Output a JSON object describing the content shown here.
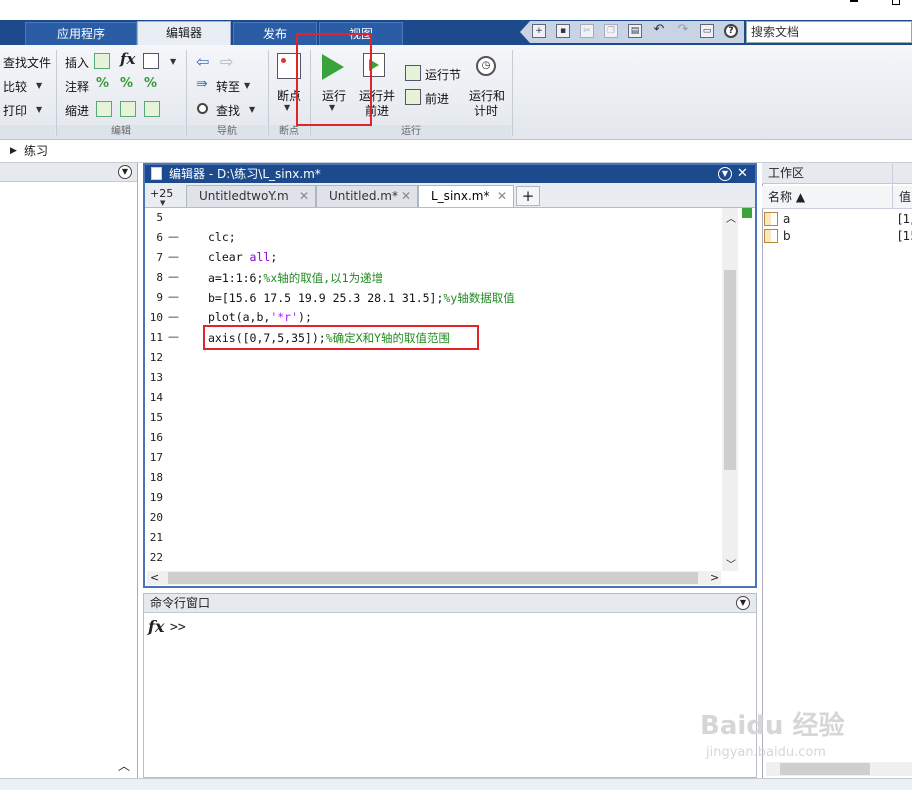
{
  "tabs": [
    {
      "label": "应用程序",
      "active": false
    },
    {
      "label": "编辑器",
      "active": true
    },
    {
      "label": "发布",
      "active": false
    },
    {
      "label": "视图",
      "active": false
    }
  ],
  "search": {
    "placeholder": "搜索文档"
  },
  "ribbon": {
    "file": {
      "find_files": "查找文件",
      "compare": "比较",
      "print": "打印"
    },
    "edit": {
      "insert": "插入",
      "comment": "注释",
      "indent": "缩进",
      "fx": "fx",
      "group": "编辑"
    },
    "navigate": {
      "goto": "转至",
      "find": "查找",
      "group": "导航"
    },
    "breakpoints": {
      "label": "断点",
      "group": "断点"
    },
    "run": {
      "run": "运行",
      "run_advance_line1": "运行并",
      "run_advance_line2": "前进",
      "run_section": "运行节",
      "advance": "前进",
      "run_time_line1": "运行和",
      "run_time_line2": "计时",
      "group": "运行"
    }
  },
  "address": {
    "crumb": "练习"
  },
  "editor": {
    "title": "编辑器 - D:\\练习\\L_sinx.m*",
    "tab_more": "+25",
    "tabs": [
      {
        "label": "UntitledtwoY.m",
        "active": false
      },
      {
        "label": "Untitled.m*",
        "active": false
      },
      {
        "label": "L_sinx.m*",
        "active": true
      }
    ],
    "add_tab": "+",
    "lines": [
      {
        "num": "5",
        "dash": "",
        "code": ""
      },
      {
        "num": "6",
        "dash": "—",
        "code": "clc;"
      },
      {
        "num": "7",
        "dash": "—",
        "code": "clear all;"
      },
      {
        "num": "8",
        "dash": "—",
        "code": "a=1:1:6;%x轴的取值,以1为递增"
      },
      {
        "num": "9",
        "dash": "—",
        "code": "b=[15.6 17.5 19.9 25.3 28.1 31.5];%y轴数据取值"
      },
      {
        "num": "10",
        "dash": "—",
        "code": "plot(a,b,'*r');"
      },
      {
        "num": "11",
        "dash": "—",
        "code": "axis([0,7,5,35]);%确定X和Y轴的取值范围"
      },
      {
        "num": "12",
        "dash": "",
        "code": ""
      },
      {
        "num": "13",
        "dash": "",
        "code": ""
      },
      {
        "num": "14",
        "dash": "",
        "code": ""
      },
      {
        "num": "15",
        "dash": "",
        "code": ""
      },
      {
        "num": "16",
        "dash": "",
        "code": ""
      },
      {
        "num": "17",
        "dash": "",
        "code": ""
      },
      {
        "num": "18",
        "dash": "",
        "code": ""
      },
      {
        "num": "19",
        "dash": "",
        "code": ""
      },
      {
        "num": "20",
        "dash": "",
        "code": ""
      },
      {
        "num": "21",
        "dash": "",
        "code": ""
      },
      {
        "num": "22",
        "dash": "",
        "code": ""
      }
    ]
  },
  "command_window": {
    "title": "命令行窗口",
    "fx": "fx",
    "prompt": ">>"
  },
  "workspace": {
    "title": "工作区",
    "col_name": "名称 ▲",
    "col_value": "值",
    "vars": [
      {
        "name": "a",
        "value": "[1,"
      },
      {
        "name": "b",
        "value": "[15"
      }
    ]
  },
  "watermark": {
    "brand": "Baidu 经验",
    "url": "jingyan.baidu.com"
  },
  "colors": {
    "tabbar": "#1c4a8c",
    "highlight": "#e0242a",
    "comment": "#228b22",
    "keyword": "#8b00c8"
  }
}
